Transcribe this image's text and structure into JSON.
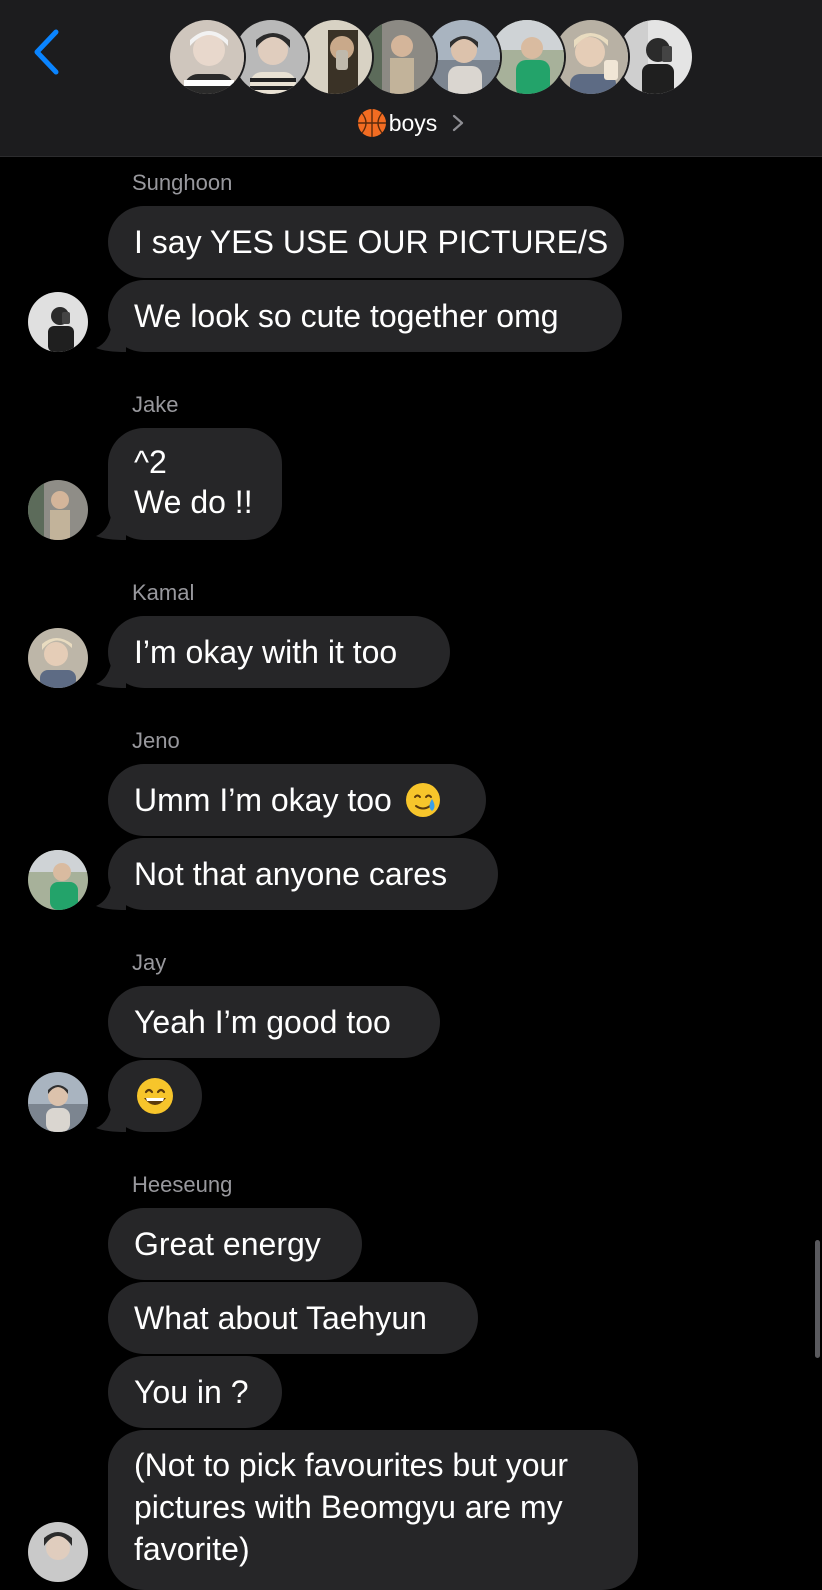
{
  "header": {
    "group_name": "boys",
    "group_emoji": "basketball-icon",
    "member_avatar_count": 8
  },
  "messages": [
    {
      "sender": "Sunghoon",
      "bubbles": [
        "I say YES USE OUR PICTURE/S",
        "We look so cute together omg"
      ]
    },
    {
      "sender": "Jake",
      "bubbles": [
        "^2\nWe do !!"
      ]
    },
    {
      "sender": "Kamal",
      "bubbles": [
        "I’m okay with it too"
      ]
    },
    {
      "sender": "Jeno",
      "bubbles": [
        "Umm I’m okay too",
        "Not that anyone cares"
      ],
      "emoji_after_first": "face-holding-back-tears"
    },
    {
      "sender": "Jay",
      "bubbles": [
        "Yeah I’m good too"
      ],
      "emoji_bubble": "grinning-face-with-smiling-eyes"
    },
    {
      "sender": "Heeseung",
      "bubbles": [
        "Great energy",
        "What about Taehyun",
        "You in ?",
        "(Not to pick favourites but your pictures with Beomgyu are my favorite)"
      ]
    }
  ],
  "colors": {
    "background": "#000000",
    "header": "#1c1c1e",
    "bubble": "#262628",
    "accent": "#0a84ff",
    "sender_name": "#98989d"
  }
}
